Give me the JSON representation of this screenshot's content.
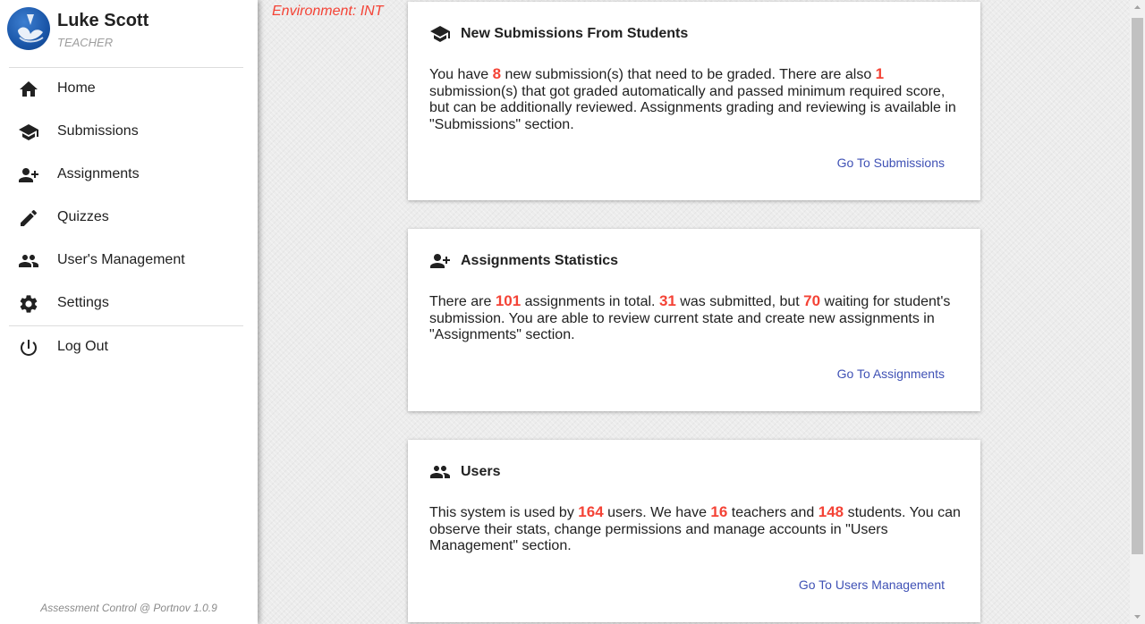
{
  "environment": "Environment: INT",
  "user": {
    "name": "Luke Scott",
    "role": "TEACHER"
  },
  "nav": {
    "items": [
      {
        "label": "Home",
        "icon": "home-icon"
      },
      {
        "label": "Submissions",
        "icon": "school-icon"
      },
      {
        "label": "Assignments",
        "icon": "person-add-icon"
      },
      {
        "label": "Quizzes",
        "icon": "pencil-icon"
      },
      {
        "label": "User's Management",
        "icon": "people-icon"
      },
      {
        "label": "Settings",
        "icon": "gear-icon"
      }
    ],
    "logout": {
      "label": "Log Out",
      "icon": "power-icon"
    }
  },
  "footer": "Assessment Control @ Portnov 1.0.9",
  "cards": {
    "submissions": {
      "title": "New Submissions From Students",
      "t1": "You have ",
      "n1": "8",
      "t2": " new submission(s) that need to be graded. There are also ",
      "n2": "1",
      "t3": " submission(s) that got graded automatically and passed minimum required score, but can be additionally reviewed. Assignments grading and reviewing is available in \"Submissions\" section.",
      "link": "Go To Submissions"
    },
    "assignments": {
      "title": "Assignments Statistics",
      "t1": "There are ",
      "n1": "101",
      "t2": " assignments in total. ",
      "n2": "31",
      "t3": " was submitted, but ",
      "n3": "70",
      "t4": " waiting for student's submission. You are able to review current state and create new assignments in \"Assignments\" section.",
      "link": "Go To Assignments"
    },
    "users": {
      "title": "Users",
      "t1": "This system is used by ",
      "n1": "164",
      "t2": " users. We have ",
      "n2": "16",
      "t3": " teachers and ",
      "n3": "148",
      "t4": " students. You can observe their stats, change permissions and manage accounts in \"Users Management\" section.",
      "link": "Go To Users Management"
    }
  },
  "colors": {
    "accent_number": "#f44336",
    "link": "#3f51b5",
    "environment": "#f44336"
  }
}
